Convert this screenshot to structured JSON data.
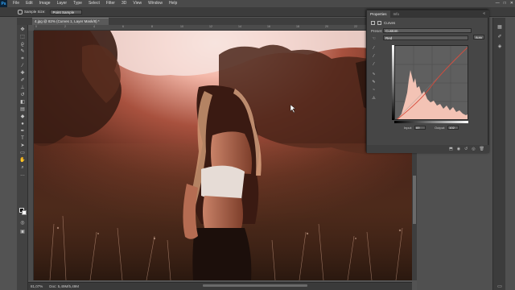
{
  "app": {
    "logo": "Ps"
  },
  "menubar": {
    "items": [
      "File",
      "Edit",
      "Image",
      "Layer",
      "Type",
      "Select",
      "Filter",
      "3D",
      "View",
      "Window",
      "Help"
    ],
    "window_controls": [
      "—",
      "□",
      "✕"
    ]
  },
  "options": {
    "sample_size_label": "Sample Size:",
    "sample_size_value": "Point Sample"
  },
  "document": {
    "tab_title": "4.jpg @ 82% (Curves 1, Layer Mask/8) *"
  },
  "ruler": {
    "marks": [
      "0",
      "2",
      "4",
      "6",
      "8",
      "10",
      "12",
      "14",
      "16",
      "18",
      "20",
      "22",
      "24"
    ]
  },
  "status": {
    "zoom": "81,07%",
    "doc_size": "Doc: 5,49M/5,49M"
  },
  "properties": {
    "tabs": [
      "Properties",
      "Info"
    ],
    "panel_title": "Curves",
    "preset_label": "Preset:",
    "preset_value": "Custom",
    "channel_value": "Red",
    "auto_button": "Auto",
    "input_label": "Input:",
    "input_value": "69",
    "output_label": "Output:",
    "output_value": "102",
    "footer_icons": [
      "clip-icon",
      "eye-icon",
      "reset-icon",
      "visibility-icon",
      "trash-icon"
    ]
  },
  "colors": {
    "histogram_fill": "#f3c3b5",
    "curve_line": "#d64a3a",
    "accent": "#31a8ff"
  },
  "icons": {
    "collapse": "«"
  }
}
